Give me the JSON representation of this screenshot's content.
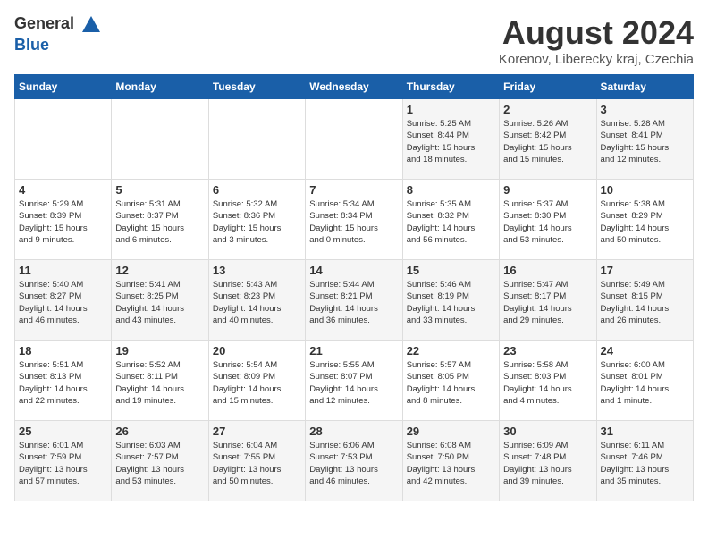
{
  "header": {
    "logo_general": "General",
    "logo_blue": "Blue",
    "title": "August 2024",
    "subtitle": "Korenov, Liberecky kraj, Czechia"
  },
  "weekdays": [
    "Sunday",
    "Monday",
    "Tuesday",
    "Wednesday",
    "Thursday",
    "Friday",
    "Saturday"
  ],
  "weeks": [
    [
      {
        "day": "",
        "info": ""
      },
      {
        "day": "",
        "info": ""
      },
      {
        "day": "",
        "info": ""
      },
      {
        "day": "",
        "info": ""
      },
      {
        "day": "1",
        "info": "Sunrise: 5:25 AM\nSunset: 8:44 PM\nDaylight: 15 hours\nand 18 minutes."
      },
      {
        "day": "2",
        "info": "Sunrise: 5:26 AM\nSunset: 8:42 PM\nDaylight: 15 hours\nand 15 minutes."
      },
      {
        "day": "3",
        "info": "Sunrise: 5:28 AM\nSunset: 8:41 PM\nDaylight: 15 hours\nand 12 minutes."
      }
    ],
    [
      {
        "day": "4",
        "info": "Sunrise: 5:29 AM\nSunset: 8:39 PM\nDaylight: 15 hours\nand 9 minutes."
      },
      {
        "day": "5",
        "info": "Sunrise: 5:31 AM\nSunset: 8:37 PM\nDaylight: 15 hours\nand 6 minutes."
      },
      {
        "day": "6",
        "info": "Sunrise: 5:32 AM\nSunset: 8:36 PM\nDaylight: 15 hours\nand 3 minutes."
      },
      {
        "day": "7",
        "info": "Sunrise: 5:34 AM\nSunset: 8:34 PM\nDaylight: 15 hours\nand 0 minutes."
      },
      {
        "day": "8",
        "info": "Sunrise: 5:35 AM\nSunset: 8:32 PM\nDaylight: 14 hours\nand 56 minutes."
      },
      {
        "day": "9",
        "info": "Sunrise: 5:37 AM\nSunset: 8:30 PM\nDaylight: 14 hours\nand 53 minutes."
      },
      {
        "day": "10",
        "info": "Sunrise: 5:38 AM\nSunset: 8:29 PM\nDaylight: 14 hours\nand 50 minutes."
      }
    ],
    [
      {
        "day": "11",
        "info": "Sunrise: 5:40 AM\nSunset: 8:27 PM\nDaylight: 14 hours\nand 46 minutes."
      },
      {
        "day": "12",
        "info": "Sunrise: 5:41 AM\nSunset: 8:25 PM\nDaylight: 14 hours\nand 43 minutes."
      },
      {
        "day": "13",
        "info": "Sunrise: 5:43 AM\nSunset: 8:23 PM\nDaylight: 14 hours\nand 40 minutes."
      },
      {
        "day": "14",
        "info": "Sunrise: 5:44 AM\nSunset: 8:21 PM\nDaylight: 14 hours\nand 36 minutes."
      },
      {
        "day": "15",
        "info": "Sunrise: 5:46 AM\nSunset: 8:19 PM\nDaylight: 14 hours\nand 33 minutes."
      },
      {
        "day": "16",
        "info": "Sunrise: 5:47 AM\nSunset: 8:17 PM\nDaylight: 14 hours\nand 29 minutes."
      },
      {
        "day": "17",
        "info": "Sunrise: 5:49 AM\nSunset: 8:15 PM\nDaylight: 14 hours\nand 26 minutes."
      }
    ],
    [
      {
        "day": "18",
        "info": "Sunrise: 5:51 AM\nSunset: 8:13 PM\nDaylight: 14 hours\nand 22 minutes."
      },
      {
        "day": "19",
        "info": "Sunrise: 5:52 AM\nSunset: 8:11 PM\nDaylight: 14 hours\nand 19 minutes."
      },
      {
        "day": "20",
        "info": "Sunrise: 5:54 AM\nSunset: 8:09 PM\nDaylight: 14 hours\nand 15 minutes."
      },
      {
        "day": "21",
        "info": "Sunrise: 5:55 AM\nSunset: 8:07 PM\nDaylight: 14 hours\nand 12 minutes."
      },
      {
        "day": "22",
        "info": "Sunrise: 5:57 AM\nSunset: 8:05 PM\nDaylight: 14 hours\nand 8 minutes."
      },
      {
        "day": "23",
        "info": "Sunrise: 5:58 AM\nSunset: 8:03 PM\nDaylight: 14 hours\nand 4 minutes."
      },
      {
        "day": "24",
        "info": "Sunrise: 6:00 AM\nSunset: 8:01 PM\nDaylight: 14 hours\nand 1 minute."
      }
    ],
    [
      {
        "day": "25",
        "info": "Sunrise: 6:01 AM\nSunset: 7:59 PM\nDaylight: 13 hours\nand 57 minutes."
      },
      {
        "day": "26",
        "info": "Sunrise: 6:03 AM\nSunset: 7:57 PM\nDaylight: 13 hours\nand 53 minutes."
      },
      {
        "day": "27",
        "info": "Sunrise: 6:04 AM\nSunset: 7:55 PM\nDaylight: 13 hours\nand 50 minutes."
      },
      {
        "day": "28",
        "info": "Sunrise: 6:06 AM\nSunset: 7:53 PM\nDaylight: 13 hours\nand 46 minutes."
      },
      {
        "day": "29",
        "info": "Sunrise: 6:08 AM\nSunset: 7:50 PM\nDaylight: 13 hours\nand 42 minutes."
      },
      {
        "day": "30",
        "info": "Sunrise: 6:09 AM\nSunset: 7:48 PM\nDaylight: 13 hours\nand 39 minutes."
      },
      {
        "day": "31",
        "info": "Sunrise: 6:11 AM\nSunset: 7:46 PM\nDaylight: 13 hours\nand 35 minutes."
      }
    ]
  ]
}
